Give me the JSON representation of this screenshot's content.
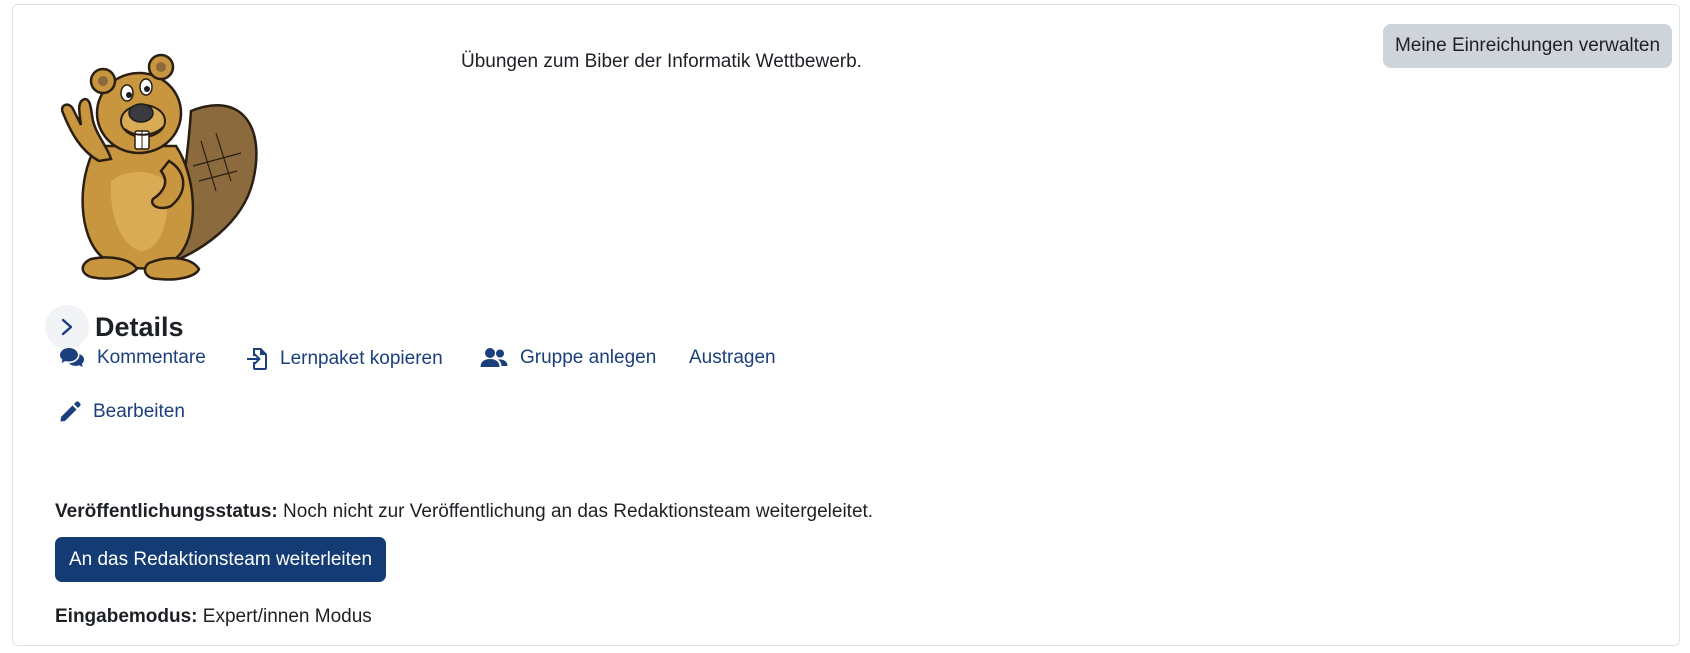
{
  "header": {
    "description": "Übungen zum Biber der Informatik Wettbewerb.",
    "manage_label": "Meine Einreichungen verwalten"
  },
  "logo": {
    "icon": "beaver-mascot-icon"
  },
  "details": {
    "title": "Details",
    "icon": "chevron-right-icon"
  },
  "actions": [
    {
      "label": "Kommentare",
      "icon": "comments-icon"
    },
    {
      "label": "Lernpaket kopieren",
      "icon": "file-import-icon"
    },
    {
      "label": "Gruppe anlegen",
      "icon": "users-icon"
    },
    {
      "label": "Austragen",
      "icon": ""
    },
    {
      "label": "Bearbeiten",
      "icon": "pencil-icon"
    }
  ],
  "publication": {
    "label": "Veröffentlichungsstatus:",
    "value": "Noch nicht zur Veröffentlichung an das Redaktionsteam weitergeleitet.",
    "forward_label": "An das Redaktionsteam weiterleiten"
  },
  "input_mode": {
    "label": "Eingabemodus:",
    "value": "Expert/innen Modus"
  },
  "colors": {
    "link": "#1a3f7c",
    "primary": "#143b73",
    "secondary": "#ced4da"
  }
}
